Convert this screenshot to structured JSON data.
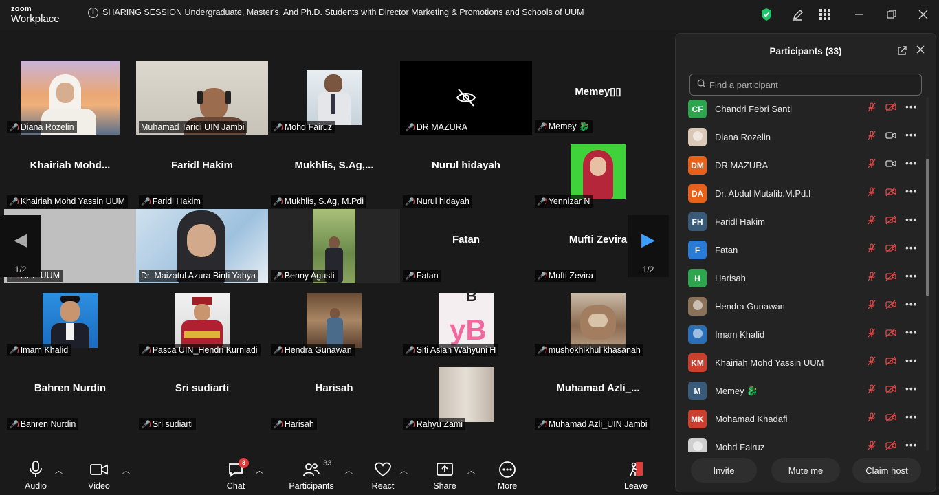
{
  "app": {
    "brand_top": "zoom",
    "brand_bottom": "Workplace"
  },
  "meeting": {
    "title": "SHARING SESSION Undergraduate, Master's, And Ph.D. Students with Director Marketing & Promotions and Schools of UUM"
  },
  "gallery": {
    "page_indicator_left": "1/2",
    "page_indicator_right": "1/2",
    "tiles": [
      {
        "label": "Diana Rozelin",
        "big": ""
      },
      {
        "label": "Muhamad Taridi UIN Jambi",
        "big": ""
      },
      {
        "label": "Mohd Fairuz",
        "big": ""
      },
      {
        "label": "DR MAZURA",
        "big": ""
      },
      {
        "label": "Memey 🐉",
        "big": "Memey▯▯"
      },
      {
        "label": "Khairiah Mohd Yassin UUM",
        "big": "Khairiah  Mohd..."
      },
      {
        "label": "Faridl Hakim",
        "big": "Faridl Hakim"
      },
      {
        "label": "Mukhlis, S.Ag, M.Pdi",
        "big": "Mukhlis,  S.Ag,..."
      },
      {
        "label": "Nurul hidayah",
        "big": "Nurul hidayah"
      },
      {
        "label": "Yennizar N",
        "big": ""
      },
      {
        "label": "HEP UUM",
        "big": ""
      },
      {
        "label": "Dr. Maizatul Azura Binti Yahya",
        "big": ""
      },
      {
        "label": "Benny Agusti",
        "big": ""
      },
      {
        "label": "Fatan",
        "big": "Fatan"
      },
      {
        "label": "Mufti Zevira",
        "big": "Mufti Zevira"
      },
      {
        "label": "Imam Khalid",
        "big": ""
      },
      {
        "label": "Pasca UIN_Hendri Kurniadi",
        "big": ""
      },
      {
        "label": "Hendra Gunawan",
        "big": ""
      },
      {
        "label": "Siti Asiah Wahyuni H",
        "big": ""
      },
      {
        "label": "mushokhikhul khasanah",
        "big": ""
      },
      {
        "label": "Bahren Nurdin",
        "big": "Bahren Nurdin"
      },
      {
        "label": "Sri sudiarti",
        "big": "Sri sudiarti"
      },
      {
        "label": "Harisah",
        "big": "Harisah"
      },
      {
        "label": "Rahyu Zami",
        "big": ""
      },
      {
        "label": "Muhamad Azli_UIN Jambi",
        "big": "Muhamad  Azli_..."
      }
    ]
  },
  "participants": {
    "title": "Participants (33)",
    "search_placeholder": "Find a participant",
    "list": [
      {
        "initials": "CF",
        "name": "Chandri Febri Santi",
        "color": "#2ea44f",
        "video": false
      },
      {
        "initials": "",
        "name": "Diana Rozelin",
        "color": "#d9c7b8",
        "video": true
      },
      {
        "initials": "DM",
        "name": "DR MAZURA",
        "color": "#e8611a",
        "video": true
      },
      {
        "initials": "DA",
        "name": "Dr. Abdul Mutalib.M.Pd.I",
        "color": "#e8611a",
        "video": false
      },
      {
        "initials": "FH",
        "name": "Faridl Hakim",
        "color": "#3a5a7a",
        "video": false
      },
      {
        "initials": "F",
        "name": "Fatan",
        "color": "#2a7bd5",
        "video": false
      },
      {
        "initials": "H",
        "name": "Harisah",
        "color": "#2ea44f",
        "video": false
      },
      {
        "initials": "",
        "name": "Hendra Gunawan",
        "color": "#8a7258",
        "video": false
      },
      {
        "initials": "",
        "name": "Imam Khalid",
        "color": "#2a6fb8",
        "video": false
      },
      {
        "initials": "KM",
        "name": "Khairiah Mohd Yassin UUM",
        "color": "#c9402f",
        "video": false
      },
      {
        "initials": "M",
        "name": "Memey 🐉",
        "color": "#3a5a7a",
        "video": false
      },
      {
        "initials": "MK",
        "name": "Mohamad Khadafi",
        "color": "#c9402f",
        "video": false
      },
      {
        "initials": "",
        "name": "Mohd Fairuz",
        "color": "#cfcfcf",
        "video": false
      }
    ],
    "buttons": {
      "invite": "Invite",
      "mute_me": "Mute me",
      "claim_host": "Claim host"
    }
  },
  "toolbar": {
    "audio": "Audio",
    "video": "Video",
    "chat": "Chat",
    "chat_badge": "3",
    "participants": "Participants",
    "participants_count": "33",
    "react": "React",
    "share": "Share",
    "more": "More",
    "leave": "Leave"
  },
  "colors": {
    "active_speaker": "#2ed37a",
    "muted": "#e04848",
    "leave": "#e03c3c",
    "shield": "#1ec36a"
  }
}
